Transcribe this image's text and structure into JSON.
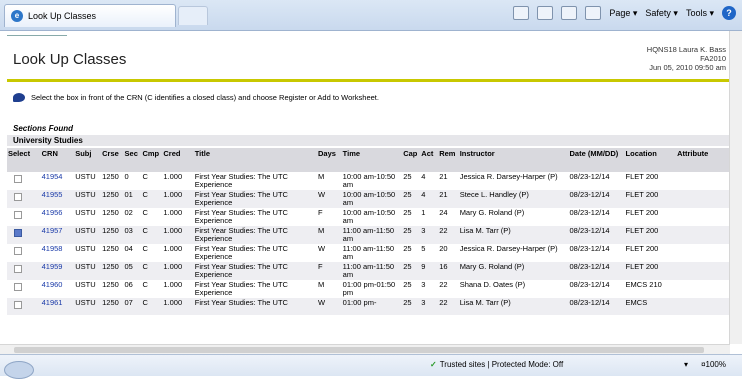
{
  "browser": {
    "tab_title": "Look Up Classes",
    "tools": {
      "page": "Page ▾",
      "safety": "Safety ▾",
      "tools": "Tools ▾"
    },
    "status_trusted": "Trusted sites | Protected Mode: Off",
    "zoom": "¤100%",
    "zoom_menu": "▾"
  },
  "page": {
    "title": "Look Up Classes",
    "meta_line1": "HQNS18 Laura K. Bass",
    "meta_line2": "FA2010",
    "meta_line3": "Jun 05, 2010 09:50 am",
    "info": "Select the box in front of the CRN (C identifies a closed class) and choose Register or Add to Worksheet.",
    "sections_found": "Sections Found",
    "group": "University Studies"
  },
  "table": {
    "headers": [
      "Select",
      "CRN",
      "Subj",
      "Crse",
      "Sec",
      "Cmp",
      "Cred",
      "Title",
      "Days",
      "Time",
      "Cap",
      "Act",
      "Rem",
      "Instructor",
      "Date (MM/DD)",
      "Location",
      "Attribute"
    ],
    "rows": [
      {
        "checked": false,
        "crn": "41954",
        "subj": "USTU",
        "crse": "1250",
        "sec": "0",
        "cmp": "C",
        "cred": "1.000",
        "title": "First Year Studies: The UTC Experience",
        "days": "M",
        "time": "10:00 am-10:50 am",
        "cap": "25",
        "act": "4",
        "rem": "21",
        "instructor": "Jessica R. Darsey-Harper (P)",
        "date": "08/23-12/14",
        "location": "FLET 200",
        "attribute": ""
      },
      {
        "checked": false,
        "crn": "41955",
        "subj": "USTU",
        "crse": "1250",
        "sec": "01",
        "cmp": "C",
        "cred": "1.000",
        "title": "First Year Studies: The UTC Experience",
        "days": "W",
        "time": "10:00 am-10:50 am",
        "cap": "25",
        "act": "4",
        "rem": "21",
        "instructor": "Stece L. Handley (P)",
        "date": "08/23-12/14",
        "location": "FLET 200",
        "attribute": ""
      },
      {
        "checked": false,
        "crn": "41956",
        "subj": "USTU",
        "crse": "1250",
        "sec": "02",
        "cmp": "C",
        "cred": "1.000",
        "title": "First Year Studies: The UTC Experience",
        "days": "F",
        "time": "10:00 am-10:50 am",
        "cap": "25",
        "act": "1",
        "rem": "24",
        "instructor": "Mary G. Roland (P)",
        "date": "08/23-12/14",
        "location": "FLET 200",
        "attribute": ""
      },
      {
        "checked": true,
        "crn": "41957",
        "subj": "USTU",
        "crse": "1250",
        "sec": "03",
        "cmp": "C",
        "cred": "1.000",
        "title": "First Year Studies: The UTC Experience",
        "days": "M",
        "time": "11:00 am-11:50 am",
        "cap": "25",
        "act": "3",
        "rem": "22",
        "instructor": "Lisa M. Tarr (P)",
        "date": "08/23-12/14",
        "location": "FLET 200",
        "attribute": ""
      },
      {
        "checked": false,
        "crn": "41958",
        "subj": "USTU",
        "crse": "1250",
        "sec": "04",
        "cmp": "C",
        "cred": "1.000",
        "title": "First Year Studies: The UTC Experience",
        "days": "W",
        "time": "11:00 am-11:50 am",
        "cap": "25",
        "act": "5",
        "rem": "20",
        "instructor": "Jessica R. Darsey-Harper (P)",
        "date": "08/23-12/14",
        "location": "FLET 200",
        "attribute": ""
      },
      {
        "checked": false,
        "crn": "41959",
        "subj": "USTU",
        "crse": "1250",
        "sec": "05",
        "cmp": "C",
        "cred": "1.000",
        "title": "First Year Studies: The UTC Experience",
        "days": "F",
        "time": "11:00 am-11:50 am",
        "cap": "25",
        "act": "9",
        "rem": "16",
        "instructor": "Mary G. Roland (P)",
        "date": "08/23-12/14",
        "location": "FLET 200",
        "attribute": ""
      },
      {
        "checked": false,
        "crn": "41960",
        "subj": "USTU",
        "crse": "1250",
        "sec": "06",
        "cmp": "C",
        "cred": "1.000",
        "title": "First Year Studies: The UTC Experience",
        "days": "M",
        "time": "01:00 pm-01:50 pm",
        "cap": "25",
        "act": "3",
        "rem": "22",
        "instructor": "Shana D. Oates (P)",
        "date": "08/23-12/14",
        "location": "EMCS 210",
        "attribute": ""
      },
      {
        "checked": false,
        "crn": "41961",
        "subj": "USTU",
        "crse": "1250",
        "sec": "07",
        "cmp": "C",
        "cred": "1.000",
        "title": "First Year Studies: The UTC",
        "days": "W",
        "time": "01:00 pm-",
        "cap": "25",
        "act": "3",
        "rem": "22",
        "instructor": "Lisa M. Tarr (P)",
        "date": "08/23-12/14",
        "location": "EMCS",
        "attribute": ""
      }
    ]
  }
}
